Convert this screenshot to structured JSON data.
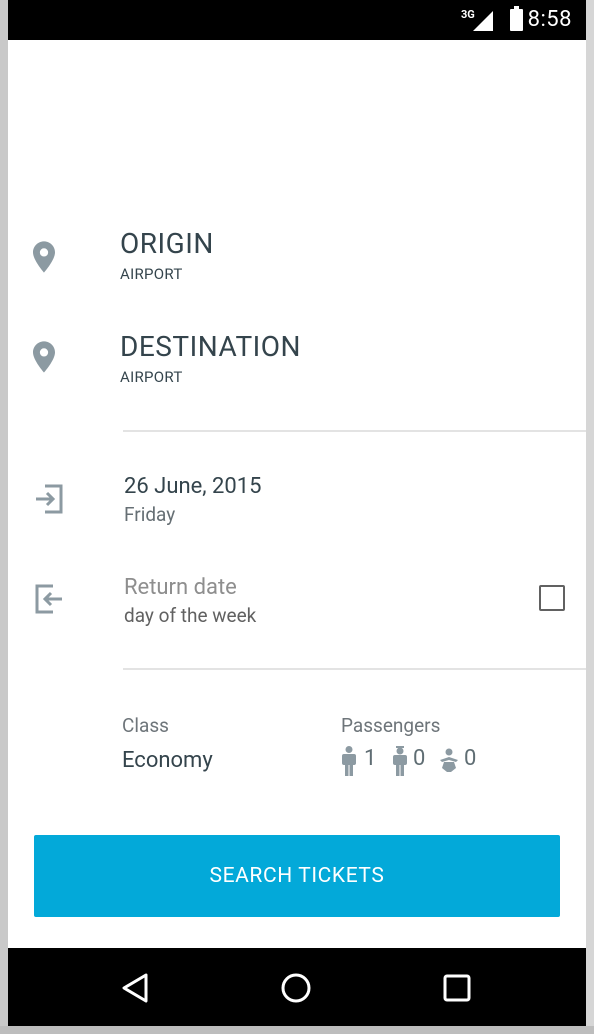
{
  "status_bar": {
    "network": "3G",
    "time": "8:58"
  },
  "origin": {
    "title": "ORIGIN",
    "subtitle": "AIRPORT",
    "icon": "location-pin-icon"
  },
  "destination": {
    "title": "DESTINATION",
    "subtitle": "AIRPORT",
    "icon": "location-pin-icon"
  },
  "departure": {
    "date": "26 June, 2015",
    "weekday": "Friday",
    "icon": "departure-icon"
  },
  "return": {
    "date": "Return date",
    "weekday": "day of the week",
    "icon": "return-icon",
    "checked": false
  },
  "class_section": {
    "label": "Class",
    "value": "Economy"
  },
  "passengers": {
    "label": "Passengers",
    "adults": "1",
    "children": "0",
    "infants": "0"
  },
  "search_button": {
    "label": "SEARCH TICKETS"
  },
  "colors": {
    "accent": "#03a9d9",
    "primary_text": "#34444c",
    "icon": "#8c9aa2"
  }
}
